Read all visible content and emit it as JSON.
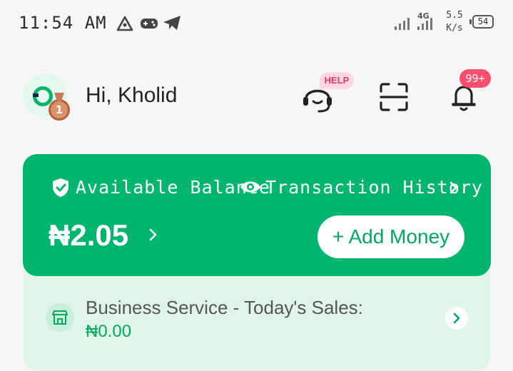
{
  "status_bar": {
    "time": "11:54 AM",
    "network_type": "4G",
    "net_speed_value": "5.5",
    "net_speed_unit": "K/s",
    "battery": "54",
    "icons": [
      "triangle-app-icon",
      "gamepad-icon",
      "telegram-icon",
      "signal-icon",
      "signal-4g-icon"
    ]
  },
  "header": {
    "greeting": "Hi, Kholid",
    "medal_level": "1",
    "help_badge": "HELP",
    "notification_badge": "99+",
    "icons": [
      "support-headset-icon",
      "scan-icon",
      "bell-icon"
    ]
  },
  "balance_card": {
    "available_label": "Available Balance",
    "transaction_label": "Transaction History",
    "amount": "₦2.05",
    "add_money_label": "+ Add Money",
    "colors": {
      "card": "#00b56e",
      "button_text": "#00a862"
    }
  },
  "business": {
    "title": "Business Service - Today's Sales:",
    "amount": "₦0.00"
  }
}
